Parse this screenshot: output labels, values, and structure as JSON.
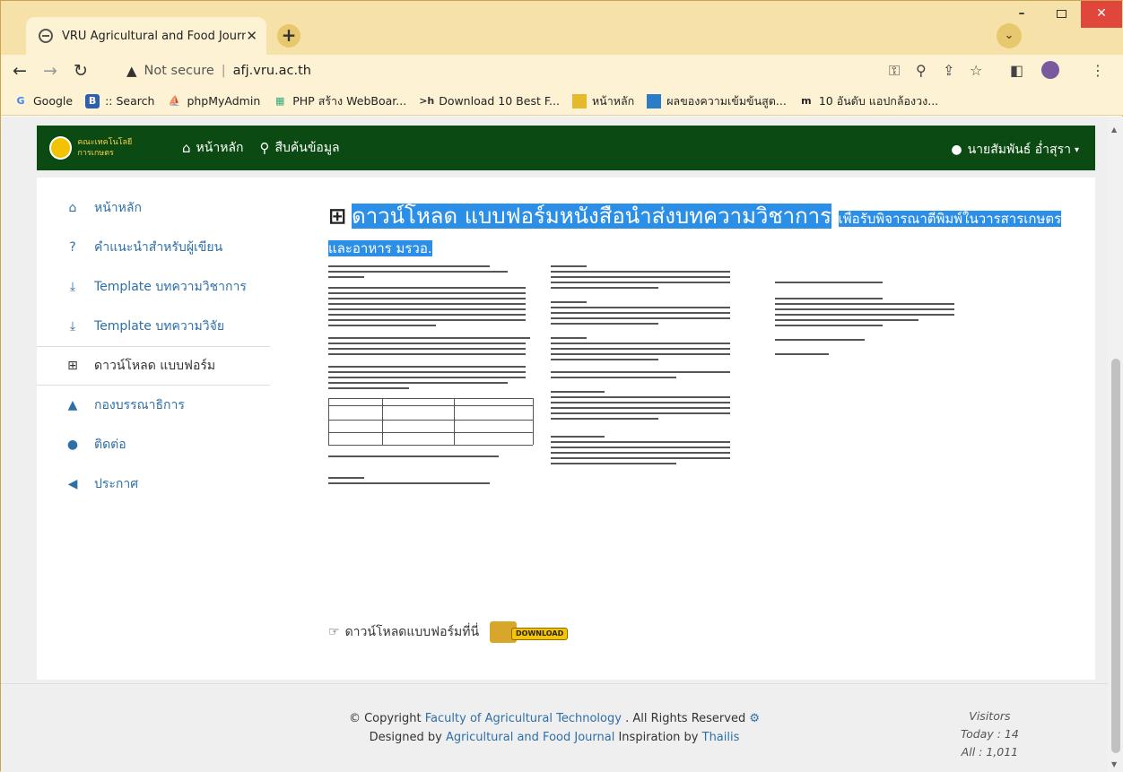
{
  "browser": {
    "tab_title": "VRU Agricultural and Food Journ",
    "url_security": "Not secure",
    "url": "afj.vru.ac.th",
    "bookmarks": [
      "Google",
      ":: Search",
      "phpMyAdmin",
      "PHP สร้าง WebBoar...",
      "Download 10 Best F...",
      "หน้าหลัก",
      "ผลของความเข้มข้นสูต...",
      "10 อันดับ แอปกล้องวง..."
    ]
  },
  "nav": {
    "home": "หน้าหลัก",
    "search": "สืบค้นข้อมูล",
    "user": "นายสัมพันธ์ อ่ำสุรา",
    "logo_text": "คณะเทคโนโลยีการเกษตร"
  },
  "sidebar": {
    "items": [
      {
        "label": "หน้าหลัก",
        "icon": "home-icon"
      },
      {
        "label": "คำแนะนำสำหรับผู้เขียน",
        "icon": "question-icon"
      },
      {
        "label": "Template บทความวิชาการ",
        "icon": "download-icon"
      },
      {
        "label": "Template บทความวิจัย",
        "icon": "download-icon"
      },
      {
        "label": "ดาวน์โหลด แบบฟอร์ม",
        "icon": "form-icon"
      },
      {
        "label": "กองบรรณาธิการ",
        "icon": "graduation-icon"
      },
      {
        "label": "ติดต่อ",
        "icon": "map-marker-icon"
      },
      {
        "label": "ประกาศ",
        "icon": "megaphone-icon"
      }
    ]
  },
  "main": {
    "title": "ดาวน์โหลด แบบฟอร์มหนังสือนำส่งบทความวิชาการ",
    "subtitle": "เพื่อรับพิจารณาตีพิมพ์ในวารสารเกษตร",
    "subtitle2": "และอาหาร มรวอ.",
    "download_text": "ดาวน์โหลดแบบฟอร์มที่นี่",
    "download_button": "DOWNLOAD"
  },
  "footer": {
    "copyright": "© Copyright",
    "org": "Faculty of Agricultural Technology",
    "rights": ". All Rights Reserved",
    "designed": "Designed by",
    "journal": "Agricultural and Food Journal",
    "inspiration": "Inspiration by",
    "thailis": "Thailis",
    "visitors": "Visitors",
    "today": "Today : 14",
    "all": "All : 1,011"
  },
  "colors": {
    "nav": "#0b4a12",
    "link": "#2f6fa7",
    "highlight": "#2b8fe7"
  }
}
